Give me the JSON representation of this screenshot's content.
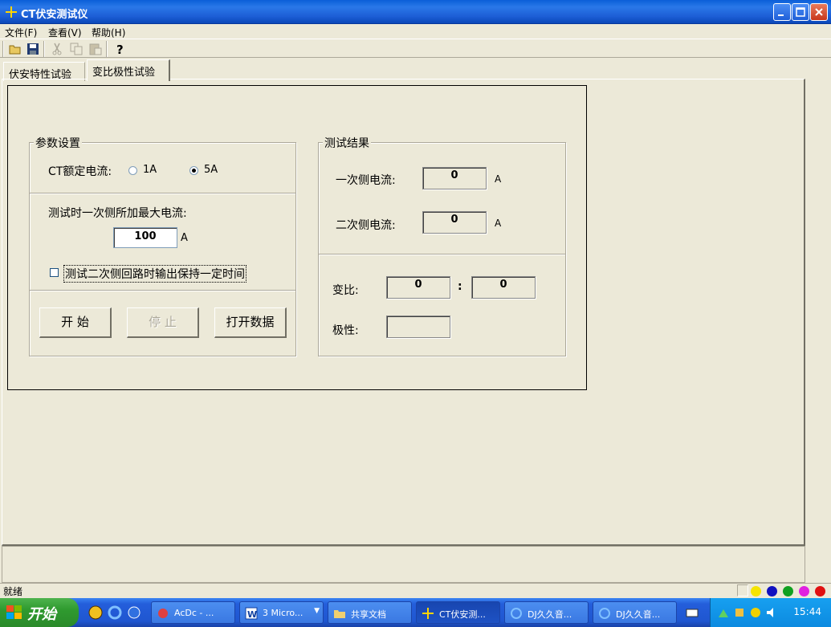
{
  "window": {
    "title": "CT伏安测试仪"
  },
  "menu": [
    "文件(F)",
    "查看(V)",
    "帮助(H)"
  ],
  "tabs": {
    "inactive": "伏安特性试验",
    "active": "变比极性试验"
  },
  "params": {
    "title": "参数设置",
    "rated_label": "CT额定电流:",
    "opt_1a": "1A",
    "opt_5a": "5A",
    "selected": "5A",
    "max_current_label": "测试时一次侧所加最大电流:",
    "max_current_value": "100",
    "unit_a": "A",
    "hold_label": "测试二次侧回路时输出保持一定时间",
    "hold_checked": false,
    "btn_start": "开 始",
    "btn_stop": "停 止",
    "btn_open": "打开数据"
  },
  "results": {
    "title": "测试结果",
    "primary_label": "一次侧电流:",
    "primary_value": "0",
    "secondary_label": "二次侧电流:",
    "secondary_value": "0",
    "unit_a": "A",
    "ratio_label": "变比:",
    "ratio_left": "0",
    "ratio_sep": ":",
    "ratio_right": "0",
    "polarity_label": "极性:",
    "polarity_value": ""
  },
  "status": {
    "text": "就绪"
  },
  "taskbar": {
    "start": "开始",
    "tasks": [
      "AcDc - ...",
      "3 Micro...",
      "共享文档",
      "CT伏安测...",
      "DJ久久音...",
      "DJ久久音..."
    ],
    "clock": "15:44"
  },
  "colors": {
    "title_bar": "#1d5ed6",
    "face": "#ece9d8",
    "taskbar": "#245edb",
    "start": "#2f9a2f"
  }
}
